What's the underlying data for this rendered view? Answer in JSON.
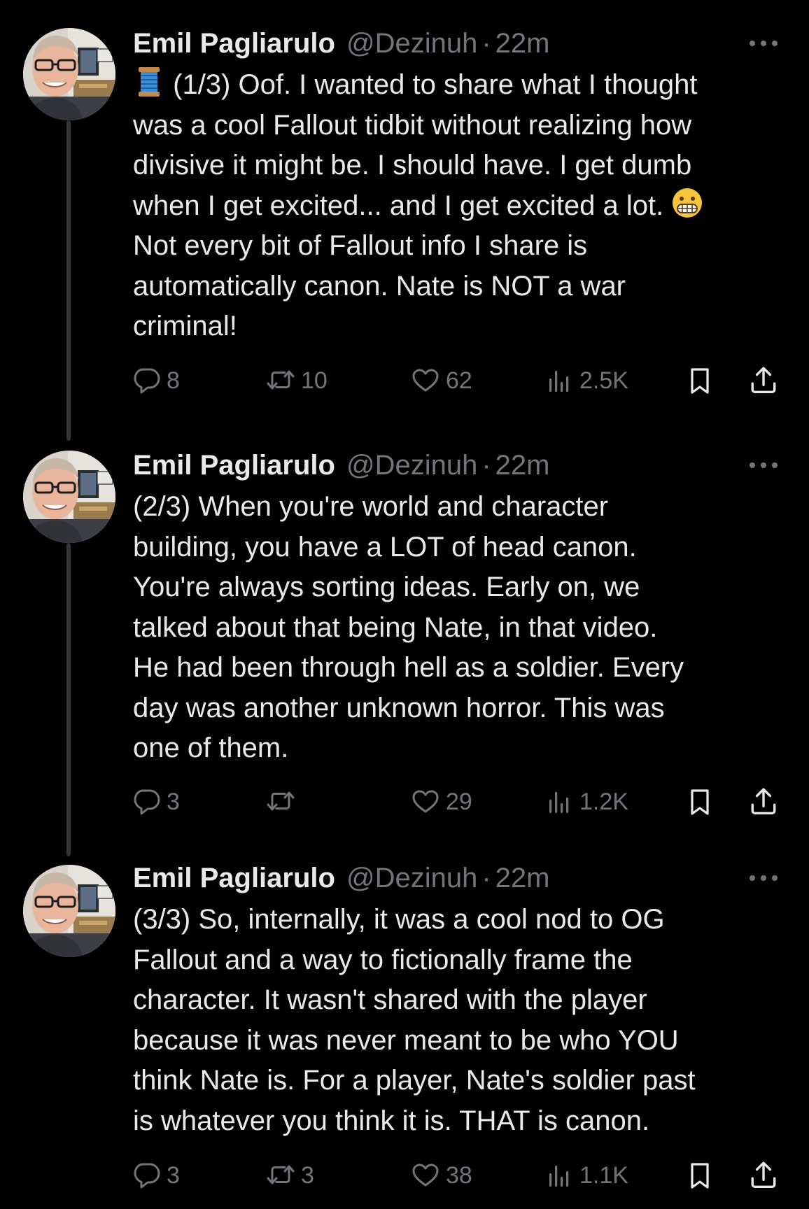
{
  "tweets": [
    {
      "name": "Emil Pagliarulo",
      "handle": "@Dezinuh",
      "separator": "·",
      "time": "22m",
      "prefix_emoji": "🧵",
      "text": "(1/3) Oof. I wanted to share what I thought\nwas a cool Fallout tidbit without realizing how\ndivisive it might be. I should have. I get dumb\nwhen I get excited... and I get excited a lot. ",
      "trailing_emoji": "😬",
      "text_after": "\nNot every bit of Fallout info I share is\nautomatically canon. Nate is NOT a war\ncriminal!",
      "replies": "8",
      "retweets": "10",
      "likes": "62",
      "views": "2.5K"
    },
    {
      "name": "Emil Pagliarulo",
      "handle": "@Dezinuh",
      "separator": "·",
      "time": "22m",
      "text": "(2/3) When you're world and character\nbuilding, you have a LOT of head canon.\nYou're always sorting ideas. Early on, we\ntalked about that being Nate, in that video.\nHe had been through hell as a soldier. Every\nday was another unknown horror. This was\none of them.",
      "replies": "3",
      "retweets": "",
      "likes": "29",
      "views": "1.2K"
    },
    {
      "name": "Emil Pagliarulo",
      "handle": "@Dezinuh",
      "separator": "·",
      "time": "22m",
      "text": "(3/3) So, internally, it was a cool nod to OG\nFallout and a way to fictionally frame the\ncharacter. It wasn't shared with the player\nbecause it was never meant to be who YOU\nthink Nate is. For a player, Nate's soldier past\nis whatever you think it is. THAT is canon.",
      "replies": "3",
      "retweets": "3",
      "likes": "38",
      "views": "1.1K"
    }
  ],
  "icons": {
    "more": "more-icon",
    "reply": "reply-icon",
    "retweet": "retweet-icon",
    "like": "like-icon",
    "views": "views-icon",
    "bookmark": "bookmark-icon",
    "share": "share-icon"
  },
  "colors": {
    "background": "#000000",
    "text": "#e7e9ea",
    "muted": "#71767b",
    "thread_line": "#333639"
  }
}
